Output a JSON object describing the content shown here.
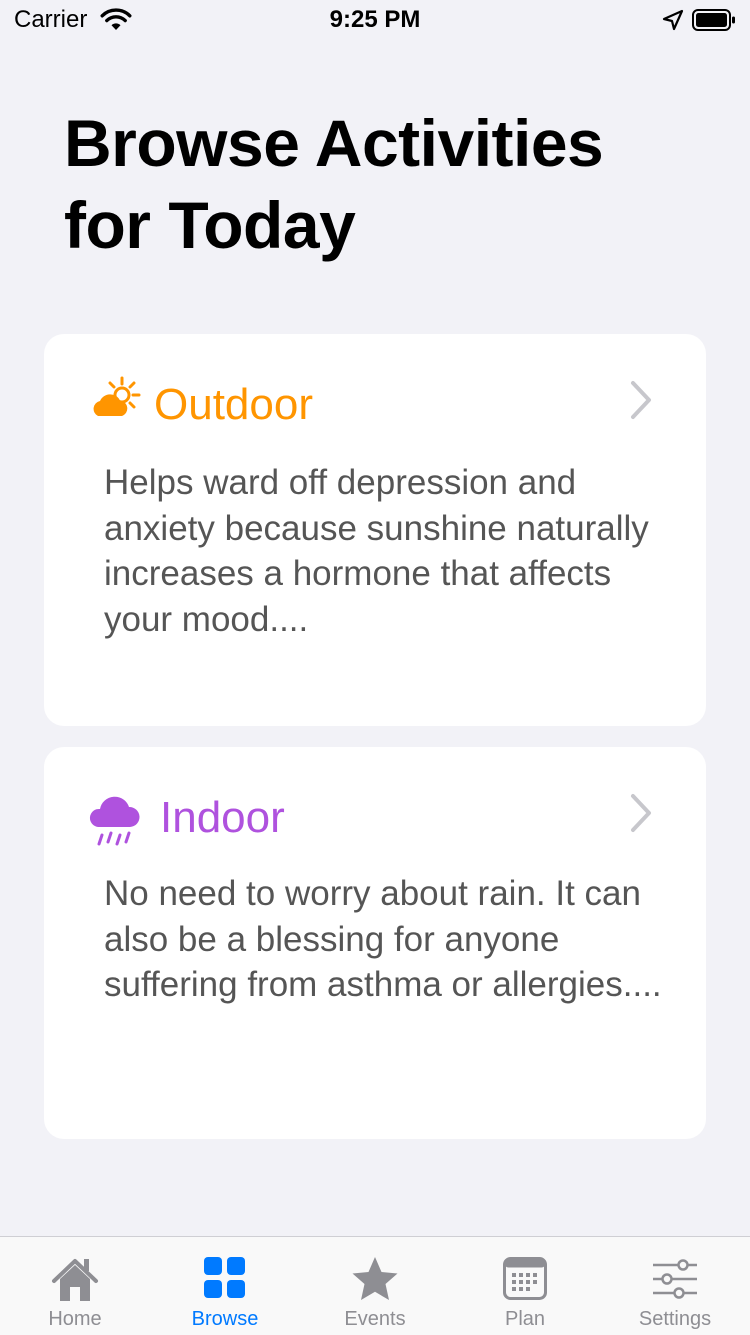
{
  "status_bar": {
    "carrier": "Carrier",
    "time": "9:25 PM"
  },
  "page": {
    "title": "Browse Activities for Today"
  },
  "cards": [
    {
      "title": "Outdoor",
      "icon": "sun-behind-cloud-icon",
      "color": "#ff9500",
      "description": "Helps ward off depression and anxiety because sunshine naturally increases a hormone that affects your mood...."
    },
    {
      "title": "Indoor",
      "icon": "cloud-rain-icon",
      "color": "#af52de",
      "description": "No need to worry about rain. It can also be a blessing for anyone suffering from asthma or allergies...."
    }
  ],
  "tab_bar": {
    "active_color": "#007aff",
    "inactive_color": "#8e8e93",
    "items": [
      {
        "label": "Home",
        "icon": "house-icon"
      },
      {
        "label": "Browse",
        "icon": "grid-icon"
      },
      {
        "label": "Events",
        "icon": "star-icon"
      },
      {
        "label": "Plan",
        "icon": "calendar-icon"
      },
      {
        "label": "Settings",
        "icon": "sliders-icon"
      }
    ],
    "selected": "Browse"
  }
}
